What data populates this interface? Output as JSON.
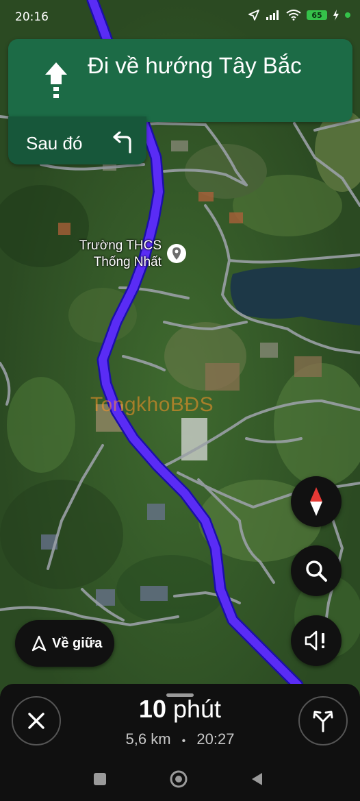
{
  "status_bar": {
    "time": "20:16",
    "battery": "65",
    "icons": [
      "location-arrow-icon",
      "signal-icon",
      "wifi-icon",
      "battery-icon",
      "charging-icon",
      "green-dot-icon"
    ]
  },
  "navigation": {
    "maneuver_icon": "arrow-up-icon",
    "instruction": "Đi về hướng Tây Bắc",
    "then_label": "Sau đó",
    "then_icon": "turn-left-icon"
  },
  "map": {
    "poi_name": "Trường THCS Thống Nhất",
    "poi_icon": "place-pin-icon",
    "watermark": "TongkhoBĐS",
    "route_color": "#5a2cf5",
    "compass_icon": "compass-icon",
    "search_icon": "search-icon",
    "sound_icon": "sound-alert-icon"
  },
  "recenter": {
    "label": "Về giữa",
    "icon": "navigation-arrow-icon"
  },
  "trip": {
    "duration_value": "10",
    "duration_unit": "phút",
    "distance": "5,6 km",
    "separator": "•",
    "arrival_time": "20:27",
    "close_icon": "close-icon",
    "alternate_routes_icon": "alternate-routes-icon"
  },
  "system_nav": {
    "icons": [
      "recents-square-icon",
      "home-circle-icon",
      "back-triangle-icon"
    ]
  }
}
